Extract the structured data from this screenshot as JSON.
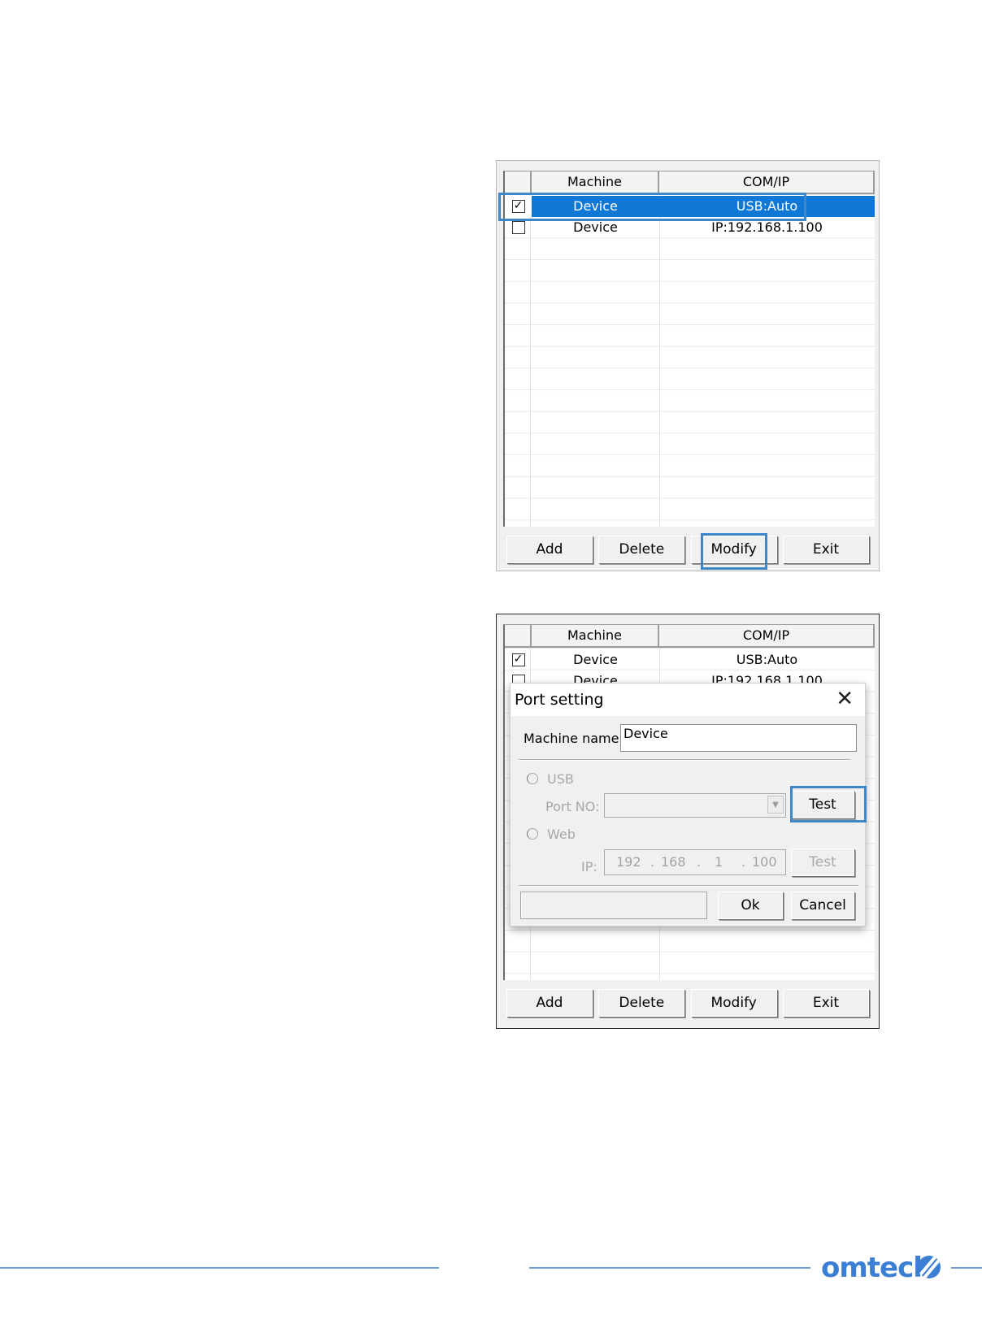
{
  "panel1": {
    "columns": {
      "check": "",
      "machine": "Machine",
      "comip": "COM/IP"
    },
    "rows": [
      {
        "checked": true,
        "machine": "Device",
        "comip": "USB:Auto"
      },
      {
        "checked": false,
        "machine": "Device",
        "comip": "IP:192.168.1.100"
      }
    ],
    "buttons": {
      "add": "Add",
      "delete": "Delete",
      "modify": "Modify",
      "exit": "Exit"
    }
  },
  "panel2": {
    "columns": {
      "check": "",
      "machine": "Machine",
      "comip": "COM/IP"
    },
    "rows": [
      {
        "checked": true,
        "machine": "Device",
        "comip": "USB:Auto"
      },
      {
        "checked": false,
        "machine": "Device",
        "comip": "IP:192.168.1.100"
      }
    ],
    "buttons": {
      "add": "Add",
      "delete": "Delete",
      "modify": "Modify",
      "exit": "Exit"
    }
  },
  "dialog": {
    "title": "Port setting",
    "close_glyph": "✕",
    "machine_name_label": "Machine name:",
    "machine_name_value": "Device",
    "usb_label": "USB",
    "port_no_label": "Port NO:",
    "port_no_value": "",
    "test_usb_label": "Test",
    "web_label": "Web",
    "ip_label": "IP:",
    "ip_octets": [
      "192",
      "168",
      "1",
      "100"
    ],
    "test_web_label": "Test",
    "status_text": "",
    "ok_label": "Ok",
    "cancel_label": "Cancel"
  },
  "footer": {
    "logo_text": "omtech",
    "brand_color": "#3a7fd4"
  },
  "colors": {
    "selection": "#0f78d7",
    "highlight_box": "#3d87c9"
  }
}
